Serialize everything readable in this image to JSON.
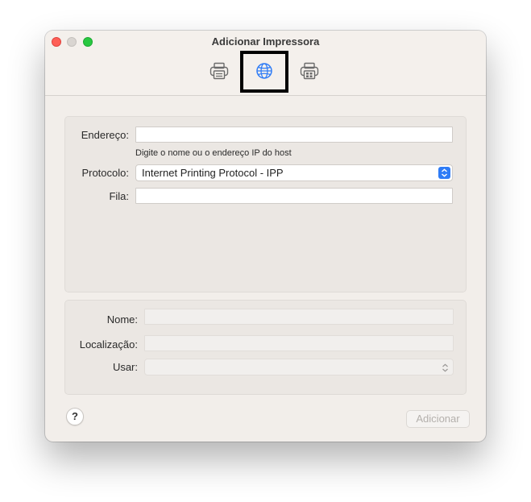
{
  "window": {
    "title": "Adicionar Impressora"
  },
  "toolbar": {
    "items": [
      {
        "icon": "default-printer-icon"
      },
      {
        "icon": "globe-ip-icon"
      },
      {
        "icon": "windows-printer-icon"
      }
    ]
  },
  "form": {
    "address_label": "Endereço:",
    "address_value": "",
    "address_hint": "Digite o nome ou o endereço IP do host",
    "protocol_label": "Protocolo:",
    "protocol_value": "Internet Printing Protocol - IPP",
    "queue_label": "Fila:",
    "queue_value": ""
  },
  "details": {
    "name_label": "Nome:",
    "name_value": "",
    "location_label": "Localização:",
    "location_value": "",
    "use_label": "Usar:",
    "use_value": ""
  },
  "footer": {
    "help_label": "?",
    "add_label": "Adicionar"
  },
  "colors": {
    "accent": "#2f7cf6",
    "close": "#fe5f57",
    "zoom": "#28c840"
  }
}
